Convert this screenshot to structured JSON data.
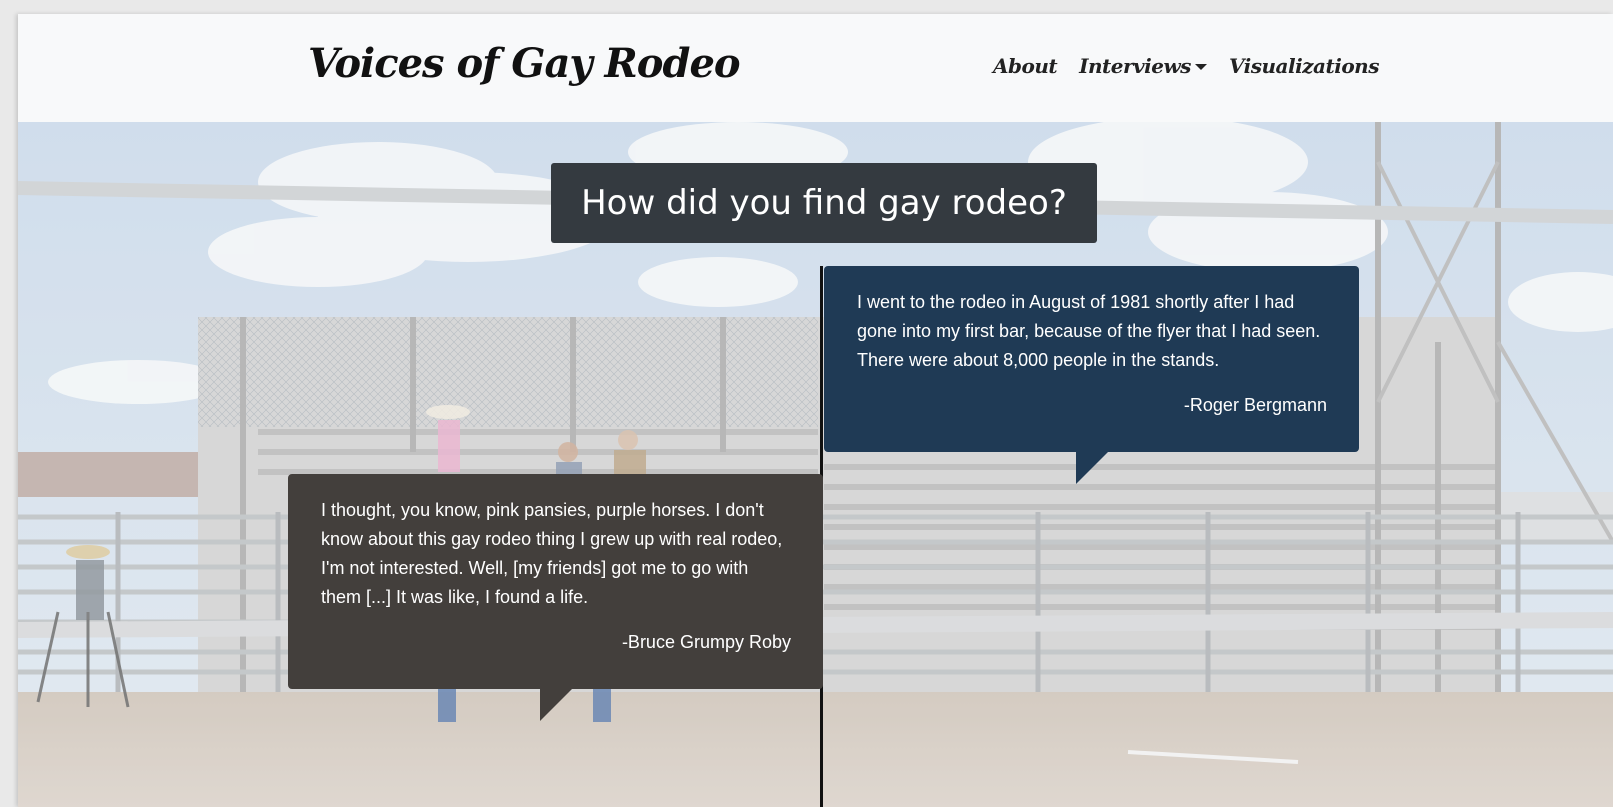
{
  "navbar": {
    "brand": "Voices of Gay Rodeo",
    "links": [
      {
        "label": "About"
      },
      {
        "label": "Interviews"
      },
      {
        "label": "Visualizations"
      }
    ]
  },
  "hero": {
    "question": "How did you find gay rodeo?",
    "quotes": [
      {
        "text": "I went to the rodeo in August of 1981 shortly after I had gone into my first bar, because of the flyer that I had seen. There were about 8,000 people in the stands.",
        "author": "-Roger Bergmann",
        "color": "#1f3a55"
      },
      {
        "text": "I thought, you know, pink pansies, purple horses. I don't know about this gay rodeo thing I grew up with real rodeo, I'm not interested. Well, [my friends] got me to go with them [...] It was like, I found a life.",
        "author": "-Bruce Grumpy Roby",
        "color": "#433f3c"
      }
    ]
  },
  "colors": {
    "navbar_bg": "#f8f9fa",
    "question_bg": "#343a40"
  }
}
